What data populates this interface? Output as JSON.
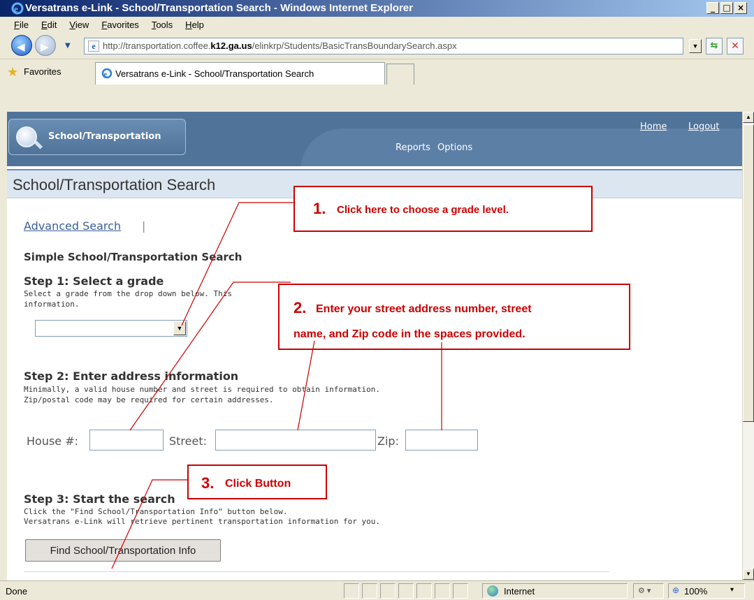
{
  "window": {
    "title": "Versatrans e-Link - School/Transportation Search - Windows Internet Explorer",
    "buttons": [
      "_",
      "□",
      "×"
    ]
  },
  "menu": [
    "File",
    "Edit",
    "View",
    "Favorites",
    "Tools",
    "Help"
  ],
  "address": {
    "prefix": "http://transportation.coffee.",
    "host_bold": "k12.ga.us",
    "suffix": "/elinkrp/Students/BasicTransBoundarySearch.aspx"
  },
  "favorites": {
    "label": "Favorites",
    "tab_title": "Versatrans e-Link - School/Transportation Search"
  },
  "site_header": {
    "search_button": "School/Transportation",
    "nav_reports": "Reports",
    "nav_options": "Options",
    "home_link": "Home",
    "logout_link": "Logout"
  },
  "page": {
    "title": "School/Transportation Search",
    "advanced_search_link": "Advanced Search",
    "separator": "|",
    "section_heading": "Simple School/Transportation Search",
    "step1_heading": "Step 1: Select a grade",
    "step1_desc_line1": "Select a grade from the drop down below. This",
    "step1_desc_line2": "information.",
    "grade_value": "",
    "step2_heading": "Step 2: Enter address information",
    "step2_desc_line1": "Minimally, a valid house number and street is required to obtain information.",
    "step2_desc_line2": "Zip/postal code may be required for certain addresses.",
    "house_label": "House #:",
    "street_label": "Street:",
    "zip_label": "Zip:",
    "house_value": "",
    "street_value": "",
    "zip_value": "",
    "step3_heading": "Step 3: Start the search",
    "step3_desc_line1": "Click the \"Find School/Transportation Info\" button below.",
    "step3_desc_line2": "Versatrans e-Link will retrieve pertinent transportation information for you.",
    "find_button": "Find School/Transportation Info"
  },
  "callouts": {
    "c1_num": "1.",
    "c1_text": "Click here to choose a grade level.",
    "c2_num": "2.",
    "c2_text_line1": "Enter your street address number, street",
    "c2_text_line2": "name, and Zip code in the spaces provided.",
    "c3_num": "3.",
    "c3_text": "Click Button"
  },
  "status": {
    "left": "Done",
    "zone": "Internet",
    "zoom": "100%"
  },
  "colors": {
    "header_blue": "#4a6f9a",
    "callout_red": "#cc0000",
    "link_blue": "#3a5f9a",
    "heading_gray": "#333333"
  }
}
